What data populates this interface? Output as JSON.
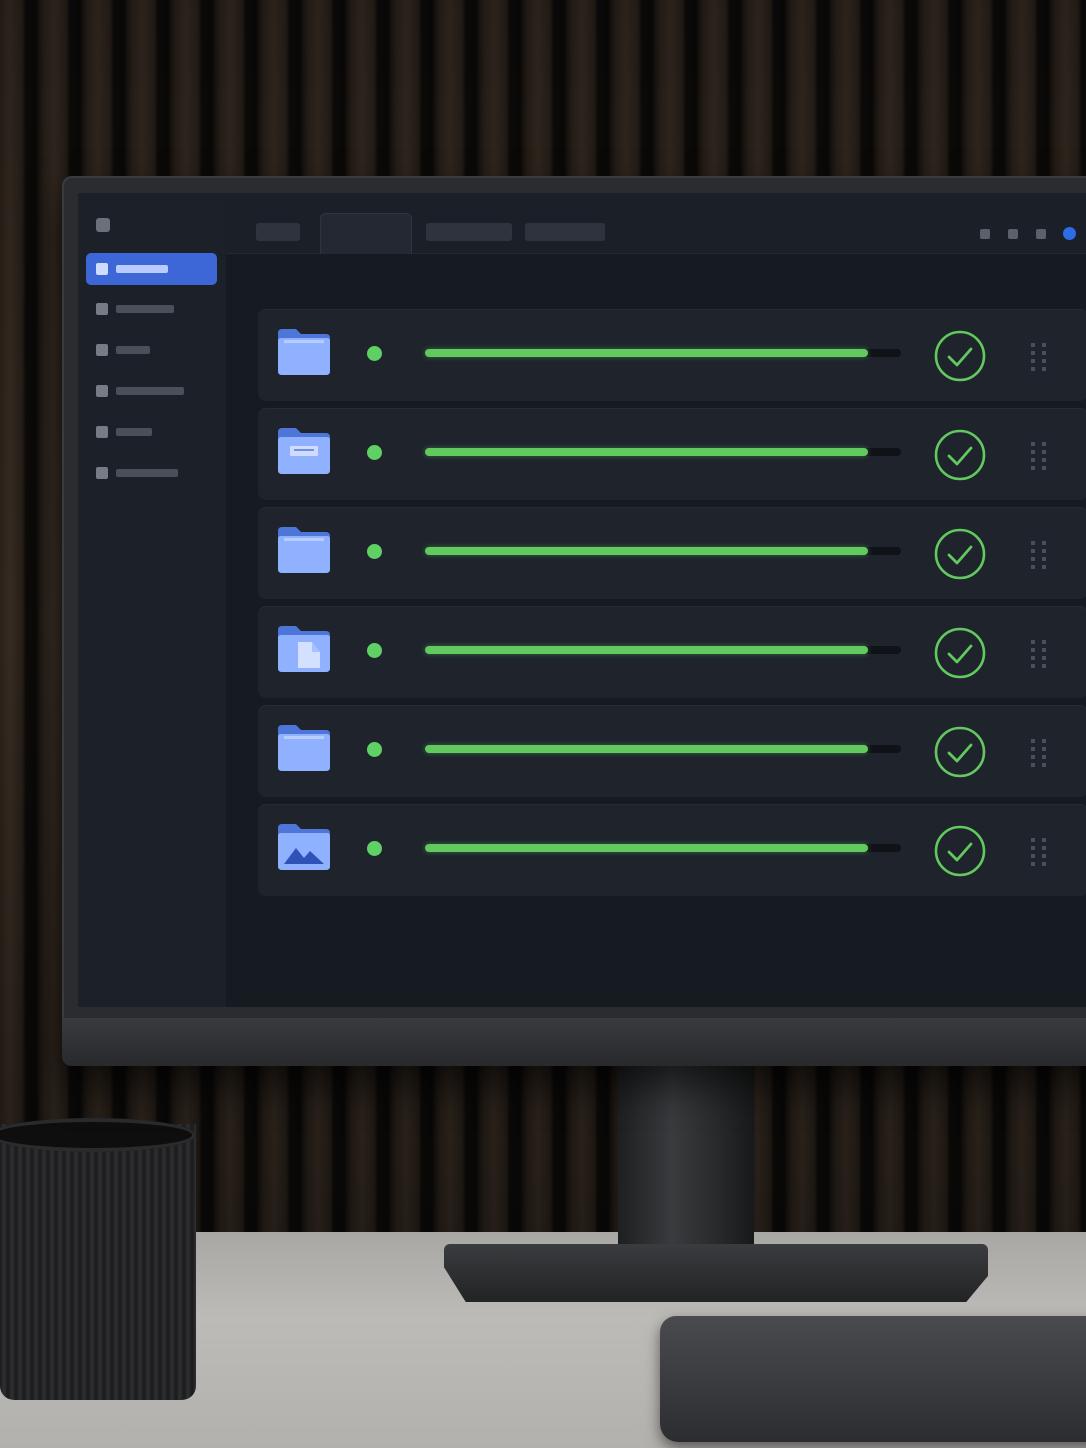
{
  "colors": {
    "accent": "#3d67d6",
    "success": "#62c95f",
    "panel": "#1e232c",
    "window_indicator": "#2e6be6"
  },
  "sidebar": {
    "items": [
      {
        "icon": "nav-icon",
        "active": true
      },
      {
        "icon": "nav-icon",
        "active": false
      },
      {
        "icon": "nav-icon",
        "active": false
      },
      {
        "icon": "nav-icon",
        "active": false
      },
      {
        "icon": "nav-icon",
        "active": false
      },
      {
        "icon": "nav-icon",
        "active": false
      }
    ]
  },
  "tabs": [
    {
      "active": false
    },
    {
      "active": true
    },
    {
      "active": false
    },
    {
      "active": false
    }
  ],
  "transfers": [
    {
      "icon": "folder-icon",
      "progress": 0.93,
      "status": "complete"
    },
    {
      "icon": "folder-document-icon",
      "progress": 0.93,
      "status": "complete"
    },
    {
      "icon": "folder-icon",
      "progress": 0.93,
      "status": "complete"
    },
    {
      "icon": "folder-file-icon",
      "progress": 0.93,
      "status": "complete"
    },
    {
      "icon": "folder-icon",
      "progress": 0.93,
      "status": "complete"
    },
    {
      "icon": "folder-image-icon",
      "progress": 0.93,
      "status": "complete"
    }
  ]
}
